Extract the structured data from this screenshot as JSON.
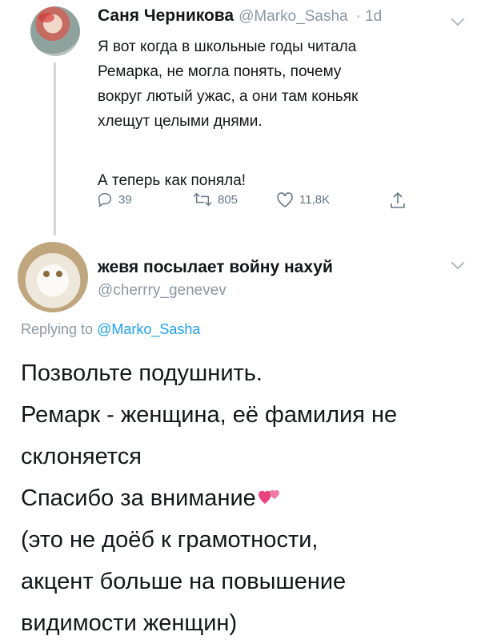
{
  "original_tweet": {
    "author_name": "Саня Черникова",
    "author_handle": "@Marko_Sasha",
    "time": "· 1d",
    "text_lines": [
      "Я вот когда в школьные годы читала",
      "Ремарка, не могла понять, почему",
      "вокруг лютый ужас, а они там коньяк",
      "хлещут целыми днями."
    ],
    "text_after": "А теперь как поняла!",
    "replies": "39",
    "retweets": "805",
    "likes": "11,8K"
  },
  "reply_tweet": {
    "author_name": "жевя посылает войну нахуй",
    "author_handle": "@cherrry_genevev",
    "replying_prefix": "Replying to",
    "replying_mention": "@Marko_Sasha",
    "text_lines": [
      "Позвольте подушнить.",
      "Ремарк - женщина, её фамилия не",
      "склоняется",
      "Спасибо за внимание",
      "(это не доёб к грамотности,",
      "акцент больше на повышение",
      "видимости женщин)"
    ]
  },
  "colors": {
    "text": "#14171a",
    "muted": "#8b98a5",
    "link": "#1da1f2",
    "thread_line": "#cdd4da",
    "emoji_heart": "#e9447c"
  },
  "icons": [
    "reply-icon",
    "retweet-icon",
    "like-icon",
    "share-icon",
    "chevron-down-icon",
    "two-hearts-emoji"
  ]
}
